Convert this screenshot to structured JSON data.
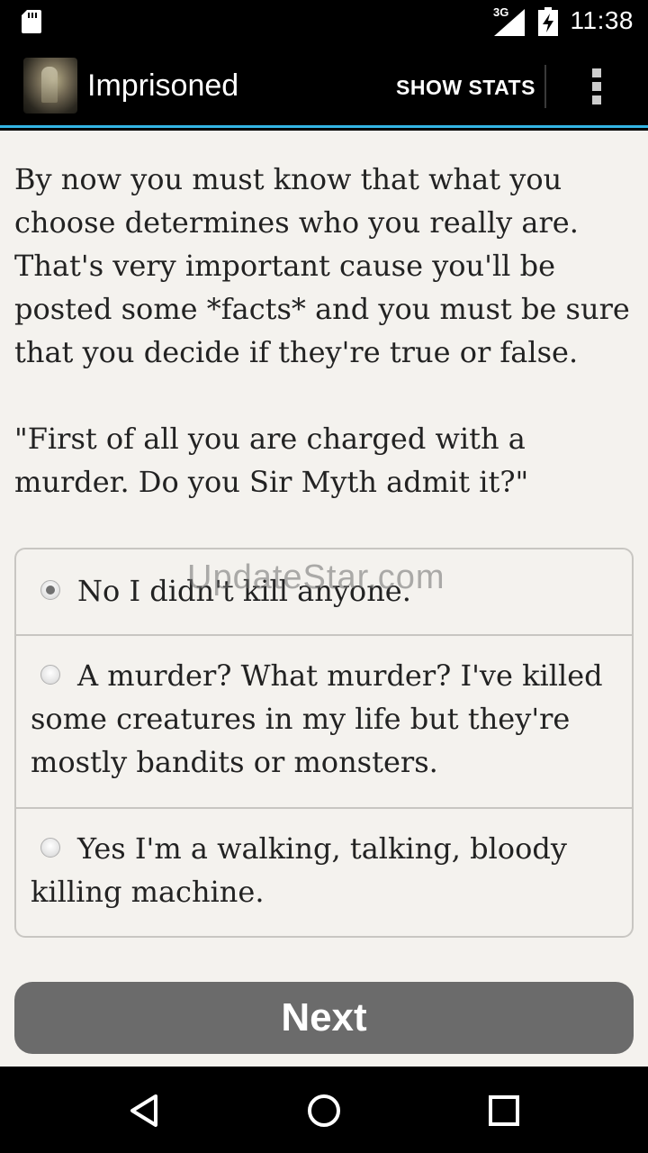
{
  "status_bar": {
    "network": "3G",
    "time": "11:38",
    "icons": [
      "sd-card-icon",
      "signal-icon",
      "battery-charging-icon"
    ]
  },
  "action_bar": {
    "title": "Imprisoned",
    "show_stats_label": "SHOW STATS",
    "overflow_icon": "overflow-menu-icon"
  },
  "story": {
    "paragraphs": [
      "By now you must know that what you choose determines who you really are. That's very important cause you'll be posted some *facts* and you must be sure that you decide if they're true or false.",
      "\"First of all you are charged with a murder. Do you Sir Myth admit it?\""
    ]
  },
  "choices": [
    {
      "label": "No I didn't kill anyone.",
      "selected": true
    },
    {
      "label": "A murder? What murder? I've killed some creatures in my life but they're mostly bandits or monsters.",
      "selected": false
    },
    {
      "label": "Yes I'm a walking, talking, bloody killing machine.",
      "selected": false
    }
  ],
  "next_label": "Next",
  "watermark": "UpdateStar.com",
  "nav_bar": {
    "icons": [
      "back-icon",
      "home-icon",
      "recents-icon"
    ]
  },
  "colors": {
    "accent": "#33b5e5",
    "content_bg": "#f4f2ee",
    "button_bg": "#6b6b6b"
  }
}
